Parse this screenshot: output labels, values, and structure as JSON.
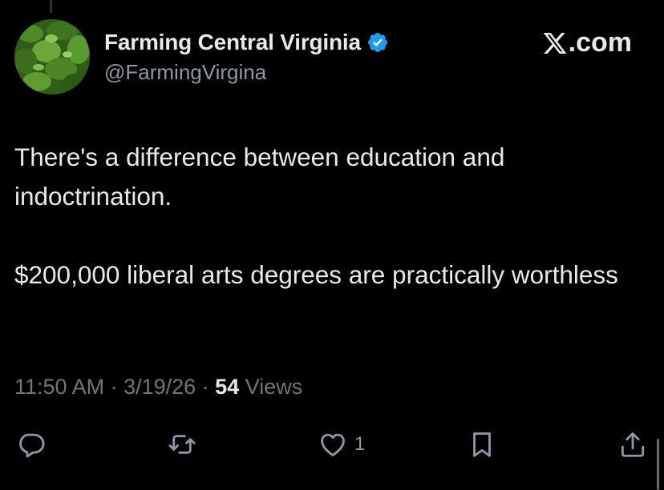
{
  "author": {
    "display_name": "Farming Central Virginia",
    "handle": "@FarmingVirgina",
    "verified": true
  },
  "brand": {
    "label": ".com",
    "logo_icon": "x-logo-icon"
  },
  "tweet": {
    "paragraph_1": "There's a difference between education and indoctrination.",
    "paragraph_2": "$200,000 liberal arts degrees are practically worthless"
  },
  "meta": {
    "time": "11:50 AM",
    "separator_1": " · ",
    "date": "3/19/26",
    "separator_2": " · ",
    "views_count": "54",
    "views_label": " Views"
  },
  "actions": {
    "reply_icon": "reply-icon",
    "retweet_icon": "retweet-icon",
    "like_icon": "heart-icon",
    "like_count": "1",
    "bookmark_icon": "bookmark-icon",
    "share_icon": "share-icon"
  },
  "colors": {
    "background": "#000000",
    "primary_text": "#e7e9ea",
    "secondary_text": "#71767b",
    "verified_blue": "#1d9bf0"
  }
}
